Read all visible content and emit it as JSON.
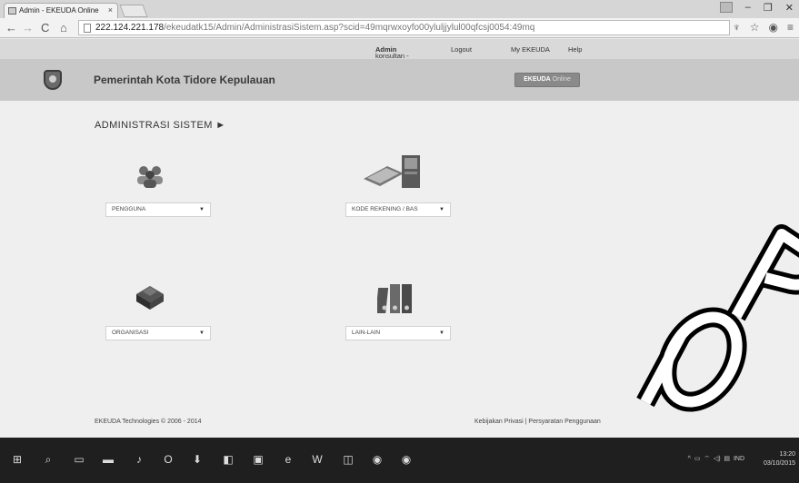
{
  "browser": {
    "tab_title": "Admin - EKEUDA Online",
    "tab_close": "×",
    "url_host": "222.124.221.178",
    "url_path": "/ekeudatk15/Admin/AdministrasiSistem.asp?scid=49mqrwxoyfo00yluljjylul00qfcsj0054:49mq",
    "back_icon": "back-arrow-icon",
    "window_minimize": "–",
    "window_maximize": "❐",
    "window_close": "✕"
  },
  "topnav": {
    "user_prefix": "konsultan - ",
    "user_role": "Admin",
    "logout": "Logout",
    "my_ekeuda": "My EKEUDA",
    "help": "Help"
  },
  "header": {
    "org_name": "Pemerintah Kota Tidore Kepulauan",
    "brand": "EKEUDA",
    "brand_suffix": " Online"
  },
  "main": {
    "section_title": "ADMINISTRASI SISTEM ►",
    "modules": [
      {
        "label": "PENGGUNA",
        "icon": "users-icon"
      },
      {
        "label": "KODE REKENING / BAS",
        "icon": "calculator-icon"
      },
      {
        "label": "ORGANISASI",
        "icon": "building-icon"
      },
      {
        "label": "LAIN-LAIN",
        "icon": "binders-icon"
      }
    ],
    "caret": "▼"
  },
  "footer": {
    "copyright": "EKEUDA Technologies © 2006 - 2014",
    "links": "Kebijakan Privasi | Persyaratan Penggunaan"
  },
  "taskbar": {
    "tray_lang": "IND",
    "time": "13:20",
    "date": "03/10/2015"
  },
  "colors": {
    "header_bg": "#c8c8c8",
    "main_bg": "#efefef",
    "taskbar_bg": "#1f1f1f"
  }
}
